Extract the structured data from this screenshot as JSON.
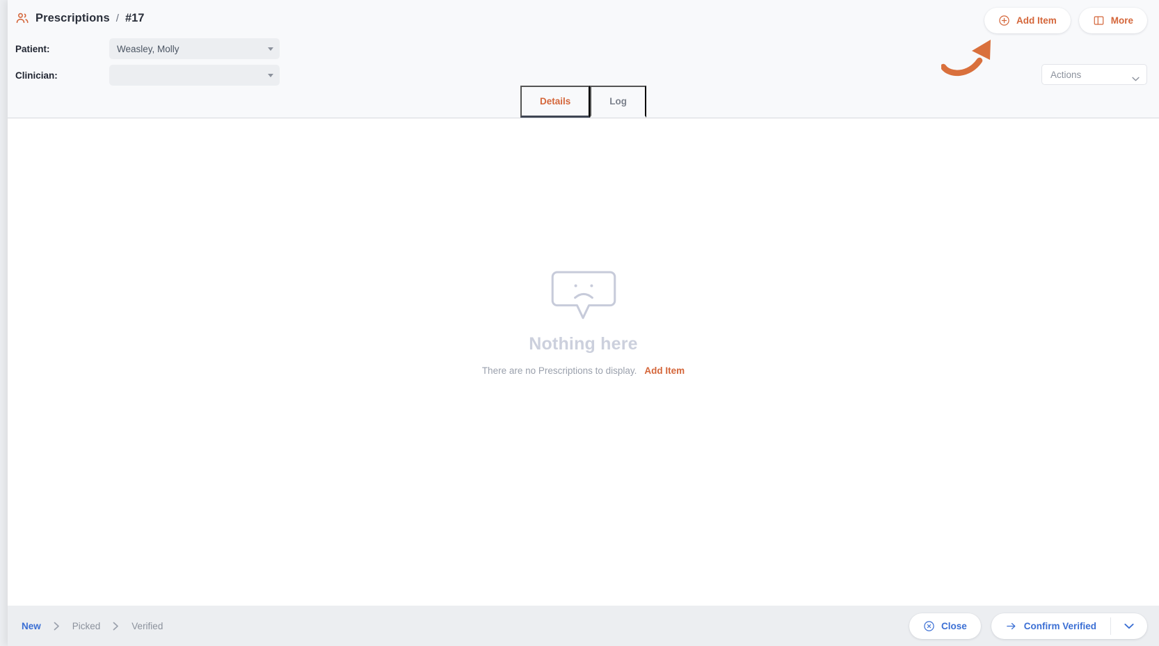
{
  "header": {
    "breadcrumb": {
      "icon": "users-icon",
      "title": "Prescriptions",
      "separator": "/",
      "record_id": "#17"
    },
    "fields": [
      {
        "label": "Patient:",
        "value": "Weasley, Molly",
        "placeholder": ""
      },
      {
        "label": "Clinician:",
        "value": "",
        "placeholder": ""
      }
    ],
    "actions": {
      "add_item": {
        "label": "Add Item",
        "icon": "plus-circle-icon"
      },
      "more": {
        "label": "More",
        "icon": "panel-layout-icon"
      }
    },
    "actions_select": {
      "placeholder": "Actions",
      "icon": "chevron-down-icon"
    },
    "annotation": {
      "type": "curved-arrow",
      "points_to": "Add Item",
      "color": "#d9703c"
    },
    "tabs": [
      {
        "label": "Details",
        "active": true
      },
      {
        "label": "Log",
        "active": false
      }
    ]
  },
  "main": {
    "empty_state": {
      "icon": "sad-speech-bubble-icon",
      "title": "Nothing here",
      "message": "There are no Prescriptions to display.",
      "action_link": "Add Item"
    }
  },
  "footer": {
    "stepper": [
      {
        "label": "New",
        "active": true
      },
      {
        "label": "Picked",
        "active": false
      },
      {
        "label": "Verified",
        "active": false
      }
    ],
    "close_button": {
      "label": "Close",
      "icon": "close-circle-icon"
    },
    "confirm_button": {
      "label": "Confirm Verified",
      "icon": "arrow-right-icon"
    },
    "confirm_dropdown_icon": "chevron-down-icon"
  },
  "colors": {
    "accent_orange": "#d4663a",
    "accent_blue": "#3b6fd4",
    "header_bg": "#f8f9fb",
    "footer_bg": "#eceef1",
    "empty_gray": "#ccd0dd"
  }
}
